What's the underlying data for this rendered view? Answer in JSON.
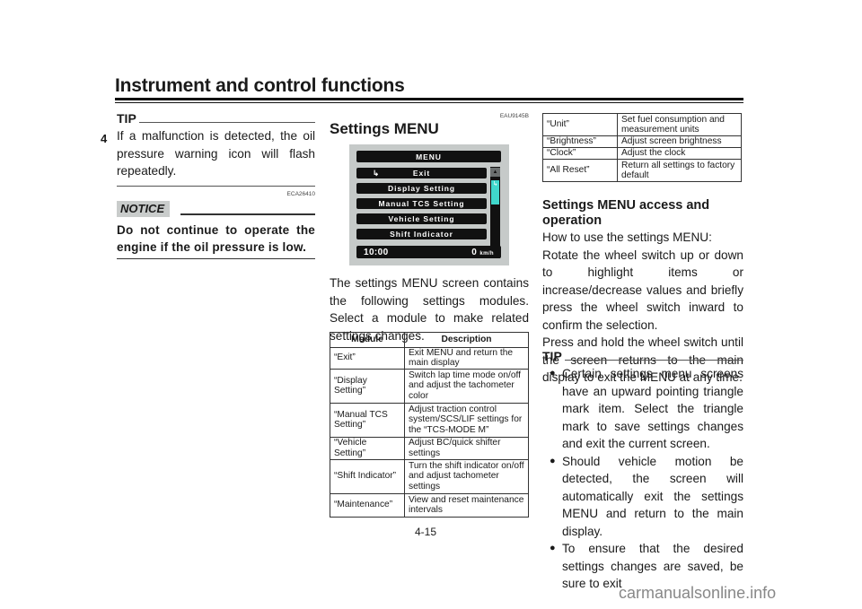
{
  "header": {
    "title": "Instrument and control functions",
    "chapter": "4"
  },
  "left_column": {
    "tip_label": "TIP",
    "tip_text": "If a malfunction is detected, the oil pressure warning icon will flash repeatedly.",
    "notice_code": "ECA26410",
    "notice_label": "NOTICE",
    "notice_text": "Do not continue to operate the engine if the oil pressure is low."
  },
  "middle_column": {
    "section_code": "EAU9145B",
    "section_title": "Settings MENU",
    "menu_screen": {
      "title": "MENU",
      "items": [
        {
          "icon": "exit-arrow-icon",
          "label": "Exit"
        },
        {
          "label": "Display Setting"
        },
        {
          "label": "Manual TCS Setting"
        },
        {
          "label": "Vehicle Setting"
        },
        {
          "label": "Shift Indicator"
        }
      ],
      "time": "10:00",
      "speed": "0",
      "speed_unit": "km/h",
      "accent_color": "#40d8cc"
    },
    "intro_text": "The settings MENU screen contains the following settings modules. Select a module to make related settings changes.",
    "table": {
      "headers": [
        "Module",
        "Description"
      ],
      "rows": [
        [
          "“Exit”",
          "Exit MENU and return the main display"
        ],
        [
          "“Display Setting”",
          "Switch lap time mode on/off and adjust the tachometer color"
        ],
        [
          "“Manual TCS Setting”",
          "Adjust traction control system/SCS/LIF settings for the “TCS-MODE M”"
        ],
        [
          "“Vehicle Setting”",
          "Adjust BC/quick shifter settings"
        ],
        [
          "“Shift Indicator”",
          "Turn the shift indicator on/off and adjust tachometer settings"
        ],
        [
          "“Maintenance”",
          "View and reset maintenance intervals"
        ]
      ]
    }
  },
  "right_column": {
    "table_rows": [
      [
        "“Unit”",
        "Set fuel consumption and measurement units"
      ],
      [
        "“Brightness”",
        "Adjust screen brightness"
      ],
      [
        "“Clock”",
        "Adjust the clock"
      ],
      [
        "“All Reset”",
        "Return all settings to factory default"
      ]
    ],
    "access_title": "Settings MENU access and operation",
    "access_intro": "How to use the settings MENU:",
    "access_p1": "Rotate the wheel switch up or down to highlight items or increase/decrease values and briefly press the wheel switch inward to confirm the selection.",
    "access_p2": "Press and hold the wheel switch until the screen returns to the main display to exit the MENU at any time.",
    "tip_label": "TIP",
    "tip_bullets": [
      "Certain settings menu screens have an upward pointing triangle mark item. Select the triangle mark to save settings changes and exit the current screen.",
      "Should vehicle motion be detected, the screen will automatically exit the settings MENU and return to the main display.",
      "To ensure that the desired settings changes are saved, be sure to exit"
    ]
  },
  "footer": {
    "page_number": "4-15",
    "watermark": "carmanualsonline.info"
  }
}
